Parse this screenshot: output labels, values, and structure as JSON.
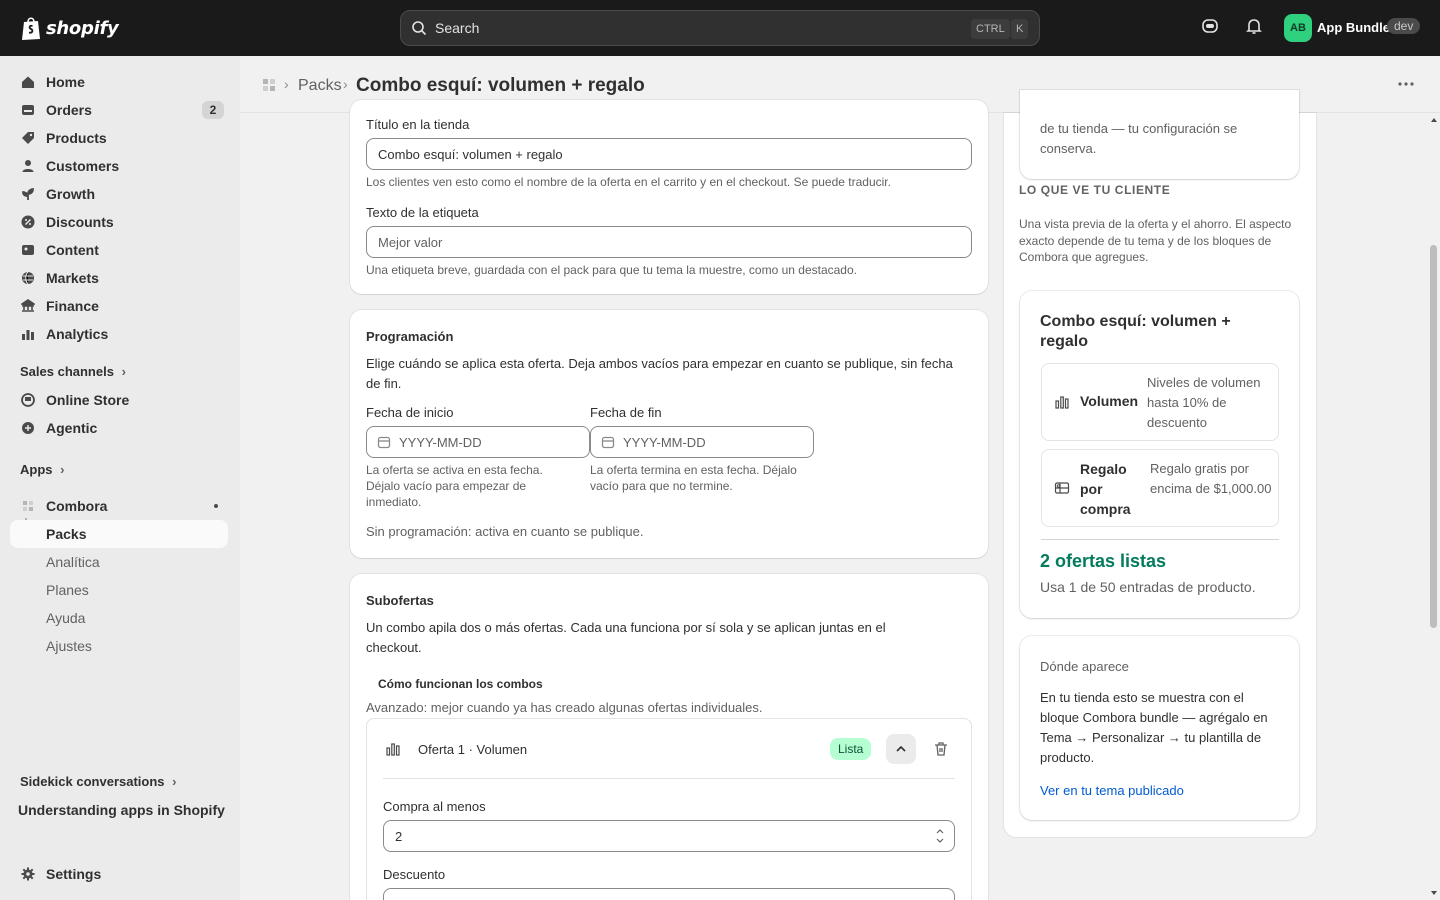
{
  "topbar": {
    "logo_text": "shopify",
    "search_placeholder": "Search",
    "shortcut_ctrl": "CTRL",
    "shortcut_k": "K",
    "avatar_initials": "AB",
    "store_name": "App Bundle",
    "dev_badge": "dev"
  },
  "sidebar": {
    "items": [
      {
        "label": "Home",
        "icon": "home-icon"
      },
      {
        "label": "Orders",
        "icon": "orders-icon",
        "count": "2"
      },
      {
        "label": "Products",
        "icon": "tag-icon"
      },
      {
        "label": "Customers",
        "icon": "person-icon"
      },
      {
        "label": "Growth",
        "icon": "growth-icon"
      },
      {
        "label": "Discounts",
        "icon": "discount-icon"
      },
      {
        "label": "Content",
        "icon": "content-icon"
      },
      {
        "label": "Markets",
        "icon": "globe-icon"
      },
      {
        "label": "Finance",
        "icon": "bank-icon"
      },
      {
        "label": "Analytics",
        "icon": "analytics-icon"
      }
    ],
    "sales_channels_label": "Sales channels",
    "channels": [
      {
        "label": "Online Store",
        "icon": "store-icon"
      },
      {
        "label": "Agentic",
        "icon": "agentic-icon"
      }
    ],
    "apps_label": "Apps",
    "app_name": "Combora",
    "app_subitems": [
      "Packs",
      "Analítica",
      "Planes",
      "Ayuda",
      "Ajustes"
    ],
    "sidekick_label": "Sidekick conversations",
    "sidekick_item": "Understanding apps in Shopify",
    "settings_label": "Settings"
  },
  "header": {
    "crumb": "Packs",
    "title": "Combo esquí: volumen + regalo"
  },
  "form": {
    "store_title_label": "Título en la tienda",
    "store_title_value": "Combo esquí: volumen + regalo",
    "store_title_help": "Los clientes ven esto como el nombre de la oferta en el carrito y en el checkout. Se puede traducir.",
    "tag_label": "Texto de la etiqueta",
    "tag_placeholder": "Mejor valor",
    "tag_help": "Una etiqueta breve, guardada con el pack para que tu tema la muestre, como un destacado."
  },
  "schedule": {
    "title": "Programación",
    "description": "Elige cuándo se aplica esta oferta. Deja ambos vacíos para empezar en cuanto se publique, sin fecha de fin.",
    "start_label": "Fecha de inicio",
    "start_placeholder": "YYYY-MM-DD",
    "start_help": "La oferta se activa en esta fecha. Déjalo vacío para empezar de inmediato.",
    "end_label": "Fecha de fin",
    "end_placeholder": "YYYY-MM-DD",
    "end_help": "La oferta termina en esta fecha. Déjalo vacío para que no termine.",
    "status": "Sin programación: activa en cuanto se publique."
  },
  "suboffers": {
    "title": "Subofertas",
    "description": "Un combo apila dos o más ofertas. Cada una funciona por sí sola y se aplican juntas en el checkout.",
    "how_title": "Cómo funcionan los combos",
    "advanced_note": "Avanzado: mejor cuando ya has creado algunas ofertas individuales.",
    "offer1_title": "Oferta 1 · Volumen",
    "offer1_badge": "Lista",
    "min_buy_label": "Compra al menos",
    "min_buy_value": "2",
    "discount_label": "Descuento"
  },
  "preview": {
    "top_text": "de tu tienda — tu configuración se conserva.",
    "section_title": "LO QUE VE TU CLIENTE",
    "section_desc": "Una vista previa de la oferta y el ahorro. El aspecto exacto depende de tu tema y de los bloques de Combora que agregues.",
    "card_title": "Combo esquí: volumen + regalo",
    "offers": [
      {
        "icon": "bar-chart-icon",
        "name": "Volumen",
        "detail": "Niveles de volumen hasta 10% de descuento"
      },
      {
        "icon": "gift-card-icon",
        "name": "Regalo por compra",
        "detail": "Regalo gratis por encima de $1,000.00"
      }
    ],
    "ready_text": "2 ofertas listas",
    "usage_text": "Usa 1 de 50 entradas de producto.",
    "where_title": "Dónde aparece",
    "where_text": "En tu tienda esto se muestra con el bloque Combora bundle — agrégalo en Tema → Personalizar → tu plantilla de producto.",
    "where_link": "Ver en tu tema publicado"
  },
  "colors": {
    "topbar": "#1a1a1a",
    "accent_green": "#047b5d",
    "link": "#005bd3",
    "badge_success_bg": "#b4fed2"
  }
}
